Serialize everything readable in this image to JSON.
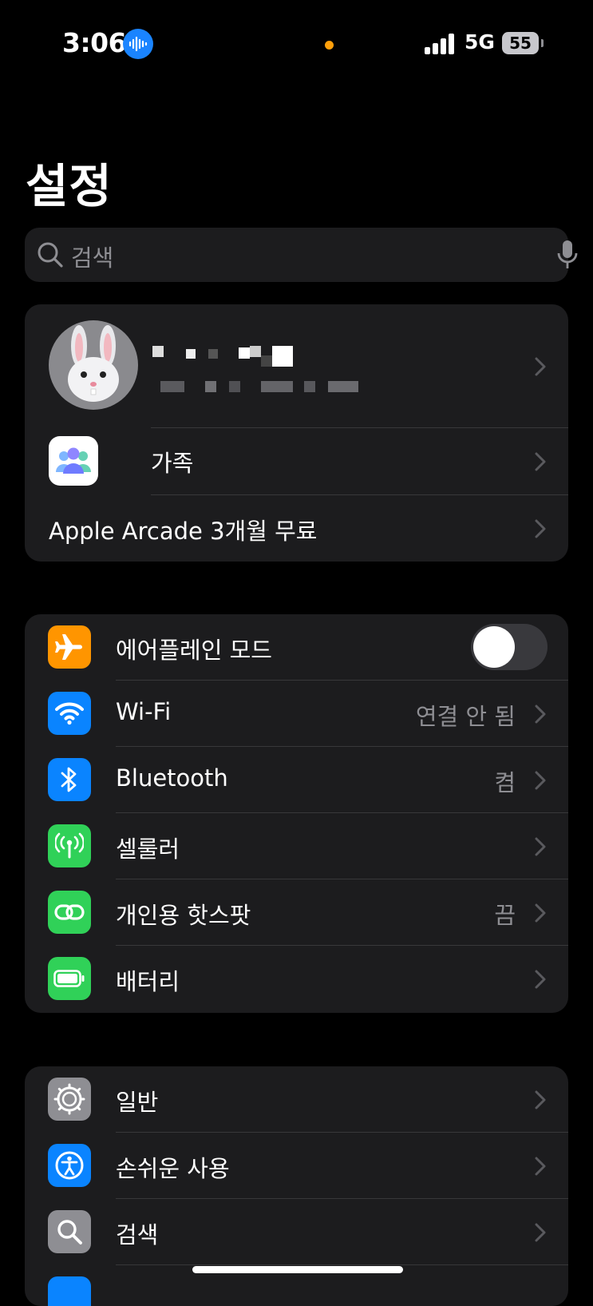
{
  "status_bar": {
    "time": "3:06",
    "network": "5G",
    "battery": "55"
  },
  "page": {
    "title": "설정"
  },
  "search": {
    "placeholder": "검색"
  },
  "profile": {
    "family_label": "가족",
    "arcade_label": "Apple Arcade 3개월 무료"
  },
  "connectivity": [
    {
      "label": "에어플레인 모드",
      "icon": "airplane-icon",
      "color": "#ff9500",
      "toggle": false
    },
    {
      "label": "Wi-Fi",
      "value": "연결 안 됨",
      "icon": "wifi-icon",
      "color": "#0a84ff"
    },
    {
      "label": "Bluetooth",
      "value": "켬",
      "icon": "bluetooth-icon",
      "color": "#0a84ff"
    },
    {
      "label": "셀룰러",
      "icon": "cellular-icon",
      "color": "#30d158"
    },
    {
      "label": "개인용 핫스팟",
      "value": "끔",
      "icon": "hotspot-icon",
      "color": "#30d158"
    },
    {
      "label": "배터리",
      "icon": "battery-icon",
      "color": "#30d158"
    }
  ],
  "general": [
    {
      "label": "일반",
      "icon": "gear-icon",
      "color": "#8e8e93"
    },
    {
      "label": "손쉬운 사용",
      "icon": "accessibility-icon",
      "color": "#0a84ff"
    },
    {
      "label": "검색",
      "icon": "search-icon",
      "color": "#8e8e93"
    }
  ]
}
